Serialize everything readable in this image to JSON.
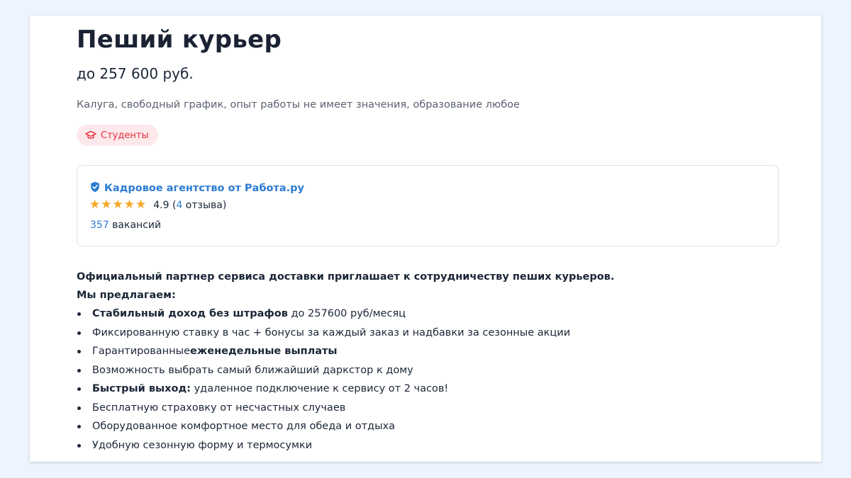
{
  "vacancy": {
    "title": "Пеший курьер",
    "salary": "до 257 600 руб.",
    "meta": "Калуга, свободный график, опыт работы не имеет значения, образование любое",
    "badge": "Студенты"
  },
  "company": {
    "name": "Кадровое агентство от Работа.ру",
    "rating": "4.9",
    "rating_open": "(",
    "reviews_count": "4",
    "reviews_word": " отзыва)",
    "stars": 5,
    "vacancies_count": "357",
    "vacancies_word": " вакансий"
  },
  "description": {
    "intro": "Официальный партнер сервиса доставки приглашает к сотрудничеству пеших курьеров.",
    "offer_heading": "Мы предлагаем:",
    "items": [
      {
        "bold": "Стабильный доход без штрафов",
        "text": " до 257600 руб/месяц"
      },
      {
        "pre": "Фиксированную ставку в час + бонусы за каждый заказ и надбавки за сезонные акции"
      },
      {
        "pre": "Гарантированные",
        "bold": "еженедельные выплаты"
      },
      {
        "pre": "Возможность выбрать самый ближайший даркстор к дому"
      },
      {
        "bold": "Быстрый выход:",
        "text": " удаленное подключение к сервису от 2 часов!"
      },
      {
        "pre": "Бесплатную страховку от несчастных случаев"
      },
      {
        "pre": "Оборудованное комфортное место для обеда и отдыха"
      },
      {
        "pre": "Удобную сезонную форму и термосумки"
      }
    ]
  },
  "icons": {
    "badge": "graduation-cap-icon",
    "verified": "shield-check-icon",
    "rating": "star-icon"
  },
  "colors": {
    "page_background": "#eef4fd",
    "link": "#2c7cd1",
    "badge_text": "#e32c3b",
    "badge_background": "#fde9eb",
    "star": "#f6a623"
  }
}
